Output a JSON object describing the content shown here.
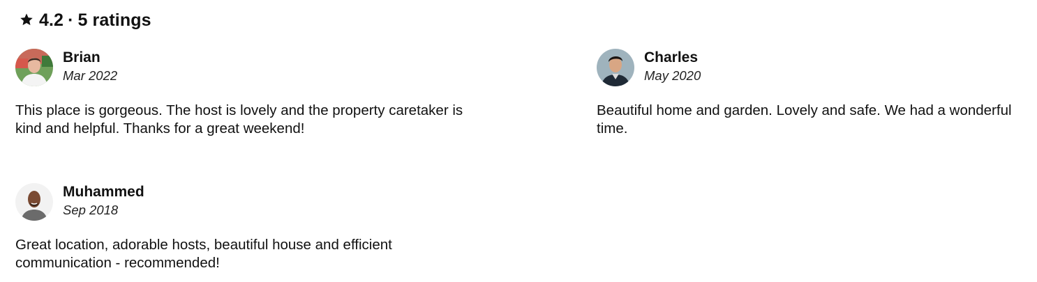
{
  "summary": {
    "rating": "4.2",
    "separator": "·",
    "count_label": "5 ratings",
    "icon": "star-icon"
  },
  "reviews": [
    {
      "name": "Brian",
      "date": "Mar 2022",
      "text": "This place is gorgeous. The host is lovely and the property caretaker is kind and helpful. Thanks for a great weekend!"
    },
    {
      "name": "Charles",
      "date": "May 2020",
      "text": "Beautiful home and garden. Lovely and safe. We had a wonderful time."
    },
    {
      "name": "Muhammed",
      "date": "Sep 2018",
      "text": "Great location, adorable hosts, beautiful house and efficient communication - recommended!"
    }
  ]
}
